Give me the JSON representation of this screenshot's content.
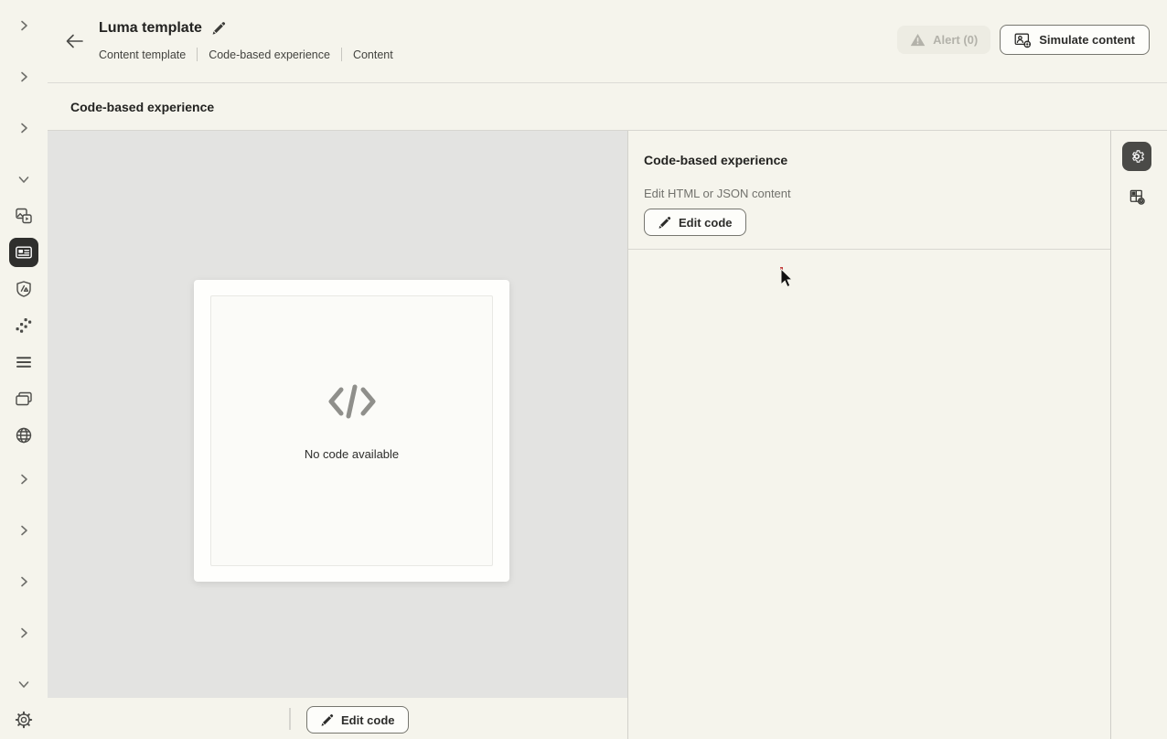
{
  "header": {
    "title": "Luma template",
    "breadcrumbs": [
      "Content template",
      "Code-based experience",
      "Content"
    ],
    "alert_label": "Alert (0)",
    "simulate_label": "Simulate content"
  },
  "section": {
    "title": "Code-based experience"
  },
  "canvas": {
    "empty_state_label": "No code available",
    "footer_edit_code_label": "Edit code"
  },
  "panel": {
    "title": "Code-based experience",
    "subtitle": "Edit HTML or JSON content",
    "edit_code_label": "Edit code"
  },
  "sidebar": {
    "items": [
      "chevron-right",
      "chevron-right",
      "chevron-right",
      "chevron-down",
      "media-assets",
      "content-templates-selected",
      "brand-shield",
      "decision-dots",
      "list-rows",
      "overlapping-cards",
      "globe",
      "chevron-right",
      "chevron-right",
      "chevron-right",
      "chevron-right",
      "chevron-down",
      "settings-gear"
    ]
  },
  "rail": {
    "items": [
      "settings-gear-active",
      "content-components"
    ]
  },
  "colors": {
    "app_background": "#f5f4ec",
    "canvas_background": "#e3e3e1",
    "selected_nav_background": "#2f2f2d",
    "rail_active_background": "#4a4a47",
    "text_dark": "#232321",
    "text_gray": "#72726d",
    "disabled_text": "#b3b2aa",
    "border": "#d2d1cb"
  }
}
